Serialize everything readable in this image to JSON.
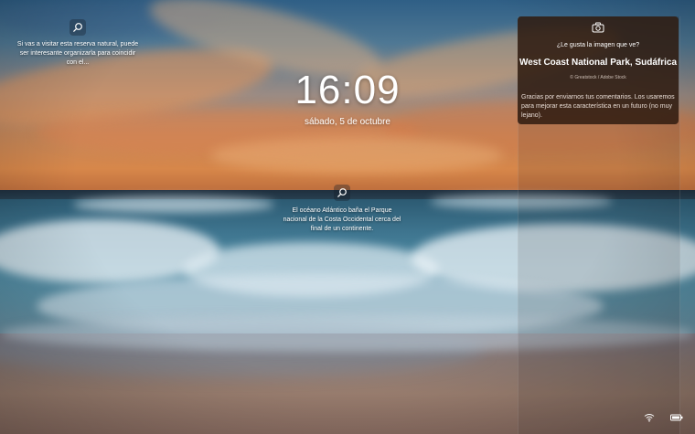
{
  "lock_screen": {
    "time": "16:09",
    "date": "sábado, 5 de octubre"
  },
  "hints": {
    "top_left": "Si vas a visitar esta reserva natural, puede ser interesante organizarla para coincidir con el...",
    "center": "El océano Atlántico baña el Parque nacional de la Costa Occidental cerca del final de un continente."
  },
  "card": {
    "question": "¿Le gusta la imagen que ve?",
    "place": "West Coast National Park, Sudáfrica",
    "credit": "© Greatstock / Adobe Stock",
    "feedback": "Gracias por enviarnos tus comentarios. Los usaremos para mejorar esta característica en un futuro (no muy lejano)."
  },
  "icons": {
    "hint_icon": "magnifier-icon",
    "card_icon": "camera-icon",
    "network_icon": "wifi-icon",
    "battery_icon": "battery-icon"
  },
  "colors": {
    "card_background": "#301c10",
    "text": "#ffffff"
  }
}
